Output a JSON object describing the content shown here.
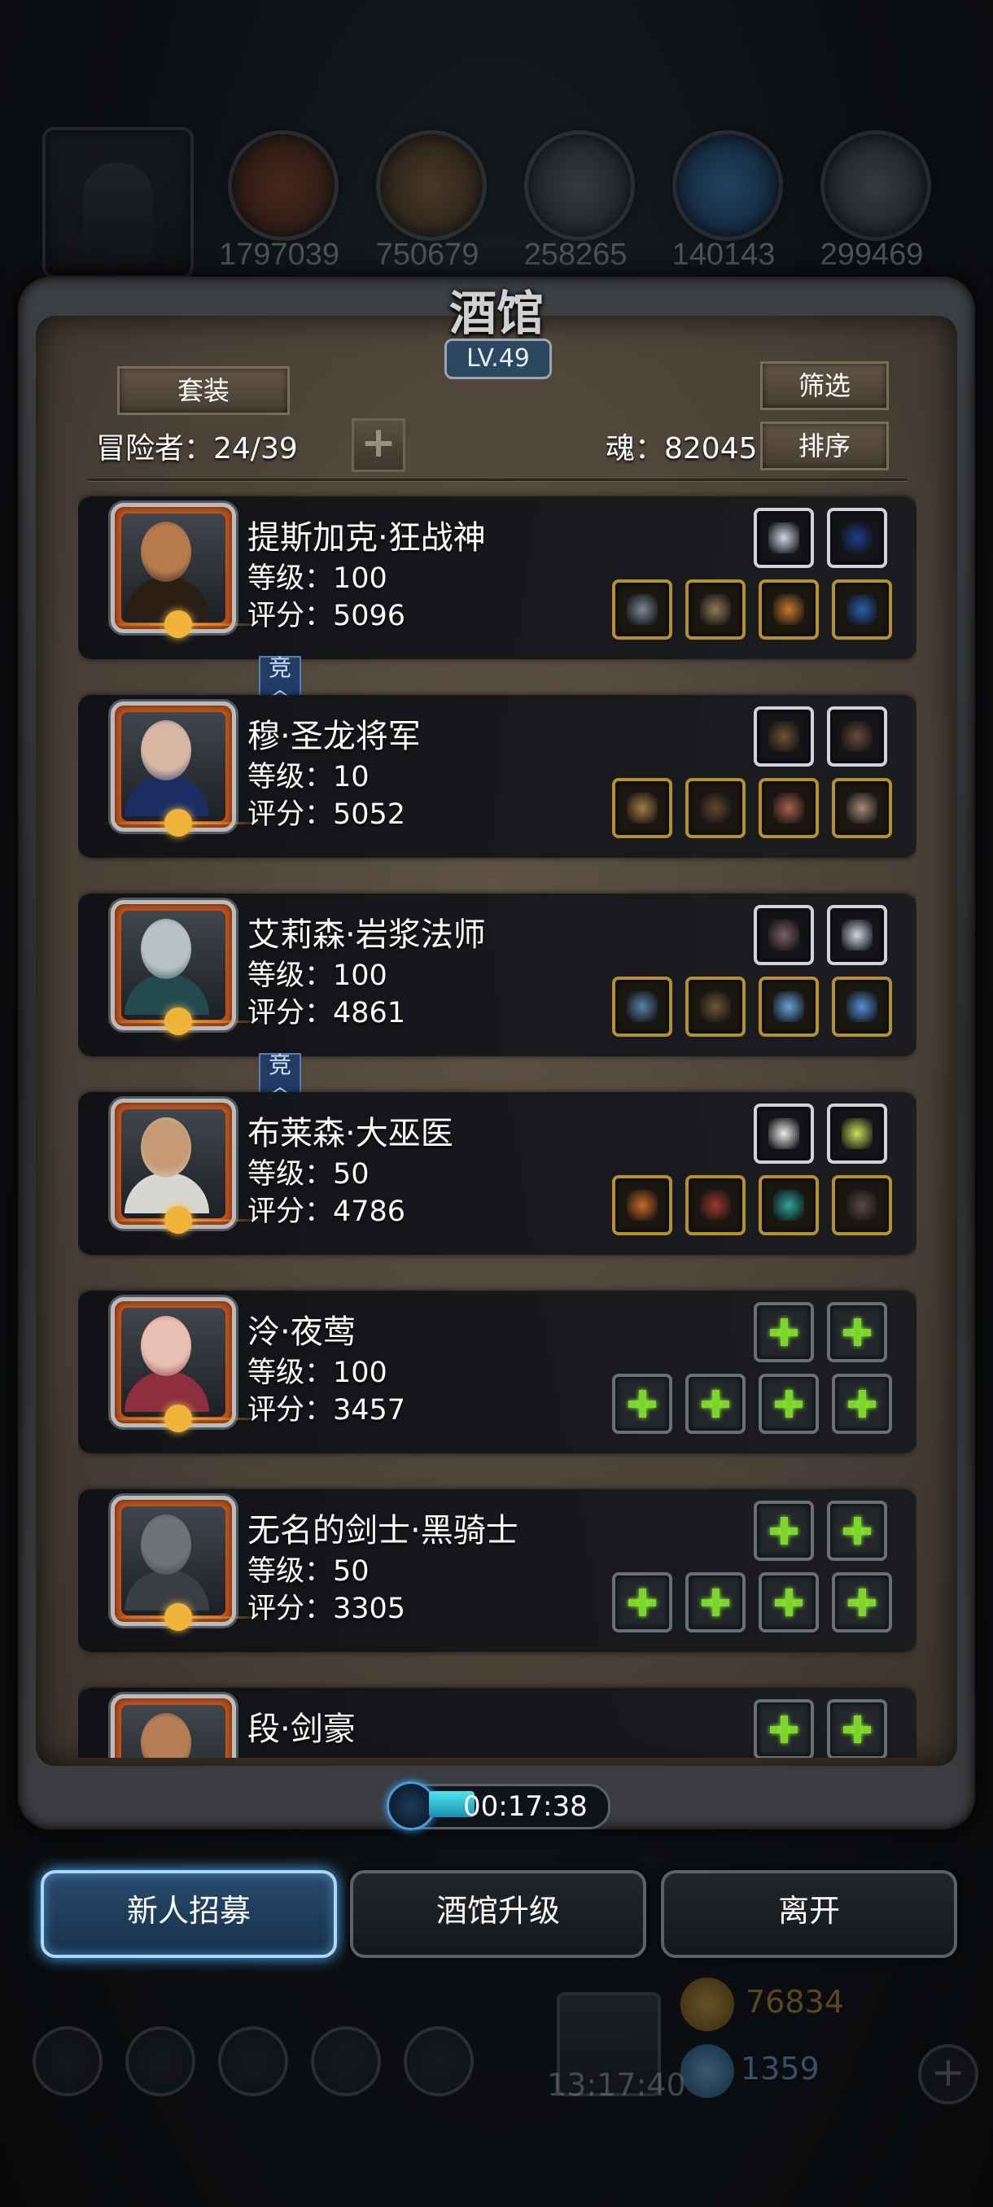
{
  "resources": {
    "values": [
      "1797039",
      "750679",
      "258265",
      "140143",
      "299469"
    ],
    "icons": [
      "meat-icon",
      "wood-icon",
      "stone-icon",
      "crystal-icon",
      "iron-icon"
    ]
  },
  "panel": {
    "title": "酒馆",
    "level": "LV.49",
    "set_button": "套装",
    "filter_button": "筛选",
    "sort_button": "排序",
    "adventurer_count": "冒险者：24/39",
    "soul": "魂：82045",
    "add_symbol": "+"
  },
  "compete_badge": "竞\n︿",
  "heroes": [
    {
      "name": "提斯加克·狂战神",
      "level": "等级：100",
      "score": "评分：5096",
      "skin": "#b67b4d",
      "hair": "#2a1d14",
      "compete": true,
      "top_slots": [
        {
          "type": "silver",
          "color": "#cfd8e6"
        },
        {
          "type": "silver",
          "color": "#1e3d8a"
        }
      ],
      "bottom_slots": [
        {
          "type": "gold",
          "color": "#7b8896"
        },
        {
          "type": "gold",
          "color": "#8e7a55"
        },
        {
          "type": "gold",
          "color": "#c87a2e"
        },
        {
          "type": "gold",
          "color": "#2c5fa8"
        }
      ]
    },
    {
      "name": "穆·圣龙将军",
      "level": "等级：10",
      "score": "评分：5052",
      "skin": "#d9b6a3",
      "hair": "#1b2d63",
      "compete": false,
      "top_slots": [
        {
          "type": "silver",
          "color": "#6e5236"
        },
        {
          "type": "silver",
          "color": "#6a4a40"
        }
      ],
      "bottom_slots": [
        {
          "type": "gold",
          "color": "#a67b47"
        },
        {
          "type": "gold",
          "color": "#5e4630"
        },
        {
          "type": "gold",
          "color": "#a86449"
        },
        {
          "type": "gold",
          "color": "#a68a7a"
        }
      ]
    },
    {
      "name": "艾莉森·岩浆法师",
      "level": "等级：100",
      "score": "评分：4861",
      "skin": "#b9c2c2",
      "hair": "#234b4f",
      "compete": true,
      "top_slots": [
        {
          "type": "silver",
          "color": "#7a6068"
        },
        {
          "type": "silver",
          "color": "#cfd8e6"
        }
      ],
      "bottom_slots": [
        {
          "type": "gold",
          "color": "#5b7fa8"
        },
        {
          "type": "gold",
          "color": "#6e5635"
        },
        {
          "type": "gold",
          "color": "#6aa3d8"
        },
        {
          "type": "gold",
          "color": "#5590d6"
        }
      ]
    },
    {
      "name": "布莱森·大巫医",
      "level": "等级：50",
      "score": "评分：4786",
      "skin": "#c59a74",
      "hair": "#d8d6d0",
      "compete": false,
      "top_slots": [
        {
          "type": "silver",
          "color": "#e9ecef"
        },
        {
          "type": "silver",
          "color": "#c9e25a"
        }
      ],
      "bottom_slots": [
        {
          "type": "gold",
          "color": "#c86a2a"
        },
        {
          "type": "gold",
          "color": "#9b3a2a"
        },
        {
          "type": "gold",
          "color": "#2fa59a"
        },
        {
          "type": "gold",
          "color": "#5a4a42"
        }
      ]
    },
    {
      "name": "泠·夜莺",
      "level": "等级：100",
      "score": "评分：3457",
      "skin": "#e8bfb1",
      "hair": "#8d2f3e",
      "compete": false,
      "top_slots": [
        {
          "type": "empty"
        },
        {
          "type": "empty"
        }
      ],
      "bottom_slots": [
        {
          "type": "empty"
        },
        {
          "type": "empty"
        },
        {
          "type": "empty"
        },
        {
          "type": "empty"
        }
      ]
    },
    {
      "name": "无名的剑士·黑骑士",
      "level": "等级：50",
      "score": "评分：3305",
      "skin": "#6f7378",
      "hair": "#3a3d41",
      "compete": false,
      "top_slots": [
        {
          "type": "empty"
        },
        {
          "type": "empty"
        }
      ],
      "bottom_slots": [
        {
          "type": "empty"
        },
        {
          "type": "empty"
        },
        {
          "type": "empty"
        },
        {
          "type": "empty"
        }
      ]
    },
    {
      "name": "段·剑豪",
      "level": "",
      "score": "",
      "skin": "#b57d55",
      "hair": "#222",
      "compete": false,
      "top_slots": [
        {
          "type": "empty"
        },
        {
          "type": "empty"
        }
      ],
      "bottom_slots": []
    }
  ],
  "timer": "00:17:38",
  "buttons": {
    "recruit": "新人招募",
    "upgrade": "酒馆升级",
    "leave": "离开"
  },
  "hud": {
    "gift_time": "13:17:40",
    "gold": "76834",
    "gems": "1359"
  }
}
